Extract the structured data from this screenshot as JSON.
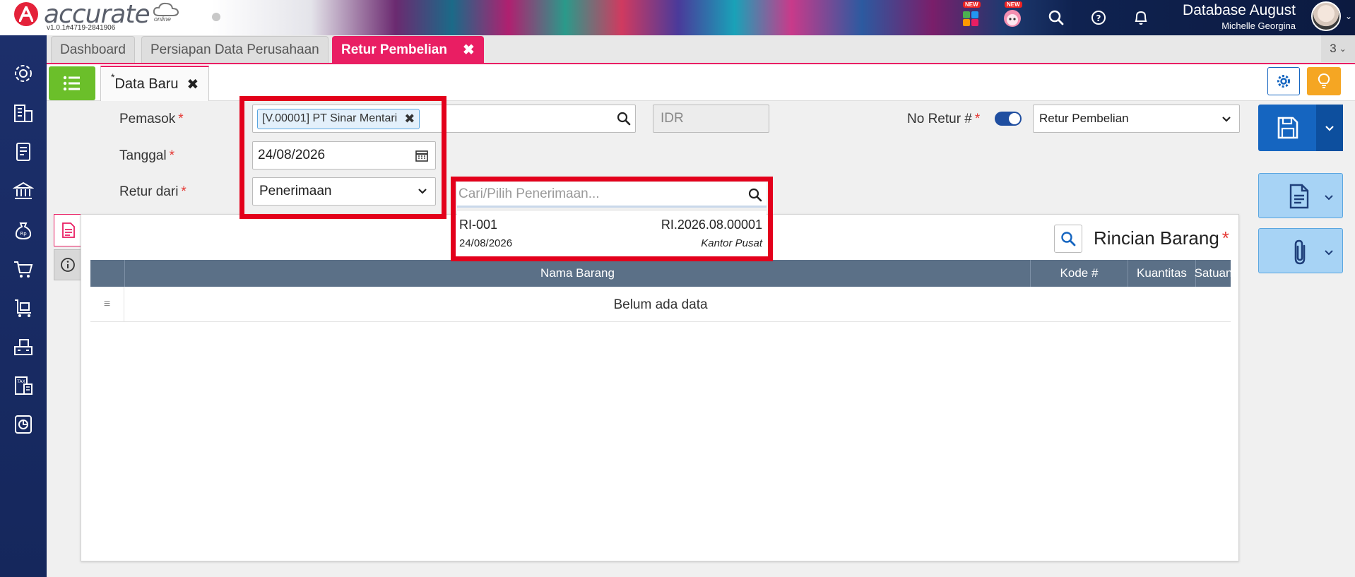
{
  "brand": {
    "name": "accurate",
    "tagline": "online",
    "version": "v1.0.1#4719-2841906"
  },
  "topbar": {
    "db_name": "Database August",
    "user_name": "Michelle Georgina",
    "badge_new": "NEW",
    "icons": [
      "apps-icon",
      "assistant-icon",
      "search-icon",
      "help-icon",
      "bell-icon"
    ]
  },
  "sidebar": {
    "items": [
      "settings-icon",
      "building-icon",
      "ledger-icon",
      "bank-icon",
      "money-bag-icon",
      "cart-icon",
      "purchase-icon",
      "inventory-icon",
      "tax-icon",
      "report-icon"
    ]
  },
  "tabs": [
    {
      "label": "Dashboard"
    },
    {
      "label": "Persiapan Data Perusahaan"
    },
    {
      "label": "Retur Pembelian",
      "active": true
    }
  ],
  "tab_count": "3",
  "subtab": {
    "star": "*",
    "label": "Data Baru"
  },
  "form": {
    "pemasok_label": "Pemasok",
    "pemasok_value": "[V.00001] PT Sinar Mentari",
    "currency": "IDR",
    "tanggal_label": "Tanggal",
    "tanggal_value": "24/08/2026",
    "retur_label": "Retur dari",
    "retur_value": "Penerimaan",
    "no_retur_label": "No Retur #",
    "no_retur_type": "Retur Pembelian",
    "required_mark": "*"
  },
  "dropdown": {
    "placeholder": "Cari/Pilih Penerimaan...",
    "items": [
      {
        "code": "RI-001",
        "number": "RI.2026.08.00001",
        "date": "24/08/2026",
        "branch": "Kantor Pusat"
      }
    ]
  },
  "panel": {
    "title": "Rincian Barang",
    "columns": [
      "Nama Barang",
      "Kode #",
      "Kuantitas",
      "Satuan"
    ],
    "empty_text": "Belum ada data"
  },
  "colors": {
    "accent": "#e91e63",
    "primary": "#1565c0",
    "green": "#6bbf2a",
    "orange": "#f5a623",
    "highlight": "#e3001b"
  }
}
